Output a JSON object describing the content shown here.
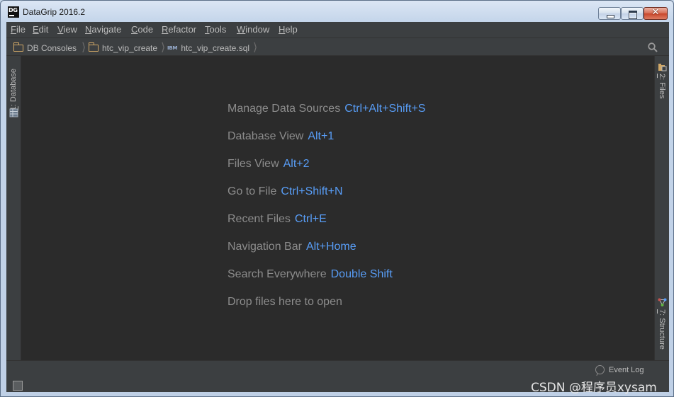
{
  "window": {
    "title": "DataGrip 2016.2",
    "app_icon_text": "DG",
    "close_glyph": "✕"
  },
  "menu": [
    {
      "mnemonic": "F",
      "rest": "ile"
    },
    {
      "mnemonic": "E",
      "rest": "dit"
    },
    {
      "mnemonic": "V",
      "rest": "iew"
    },
    {
      "mnemonic": "N",
      "rest": "avigate"
    },
    {
      "mnemonic": "C",
      "rest": "ode"
    },
    {
      "mnemonic": "R",
      "rest": "efactor"
    },
    {
      "mnemonic": "T",
      "rest": "ools"
    },
    {
      "mnemonic": "W",
      "rest": "indow"
    },
    {
      "mnemonic": "H",
      "rest": "elp"
    }
  ],
  "breadcrumb": [
    {
      "label": "DB Consoles",
      "icon": "folder-icon"
    },
    {
      "label": "htc_vip_create",
      "icon": "folder-icon"
    },
    {
      "label": "htc_vip_create.sql",
      "icon": "sql-file-icon",
      "icon_text": "IBM"
    }
  ],
  "tool_windows": {
    "left": [
      {
        "number": "1",
        "label": ": Database",
        "icon": "database-icon"
      }
    ],
    "right": [
      {
        "number": "2",
        "label": ": Files",
        "icon": "files-icon"
      },
      {
        "number": "7",
        "label": ": Structure",
        "icon": "structure-icon"
      }
    ]
  },
  "hints": [
    {
      "label": "Manage Data Sources",
      "shortcut": "Ctrl+Alt+Shift+S"
    },
    {
      "label": "Database View",
      "shortcut": "Alt+1"
    },
    {
      "label": "Files View",
      "shortcut": "Alt+2"
    },
    {
      "label": "Go to File",
      "shortcut": "Ctrl+Shift+N"
    },
    {
      "label": "Recent Files",
      "shortcut": "Ctrl+E"
    },
    {
      "label": "Navigation Bar",
      "shortcut": "Alt+Home"
    },
    {
      "label": "Search Everywhere",
      "shortcut": "Double Shift"
    },
    {
      "label": "Drop files here to open",
      "shortcut": ""
    }
  ],
  "status": {
    "event_log": "Event Log"
  },
  "watermark": "CSDN @程序员xysam",
  "colors": {
    "shortcut": "#589df6",
    "hint_text": "#8c8c8c",
    "folder": "#d1a866"
  }
}
